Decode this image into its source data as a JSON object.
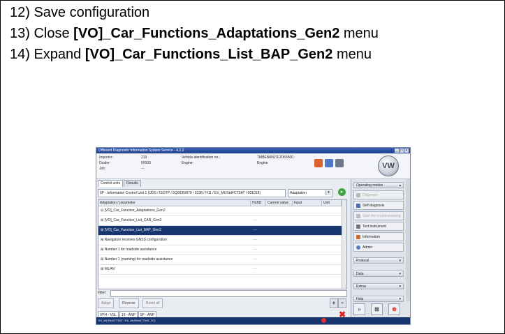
{
  "instructions": [
    {
      "text": "12) Save configuration",
      "bold": ""
    },
    {
      "text": "13) Close ",
      "bold": "[VO]_Car_Functions_Adaptations_Gen2",
      "suffix": " menu"
    },
    {
      "text": "14) Expand ",
      "bold": "[VO]_Car_Functions_List_BAP_Gen2",
      "suffix": " menu"
    }
  ],
  "app": {
    "title": "Offboard Diagnostic Information System Service - 4.2.3",
    "importer_label": "Importer:",
    "importer_value": "219",
    "dealer_label": "Dealer:",
    "dealer_value": "00000",
    "job_label": "Job:",
    "job_value": "---",
    "vin_label": "Vehicle identification no.:",
    "vin_value": "TMBEN6NJ7FZ065500",
    "engine_label": "Engine:",
    "engine_value": "Engine",
    "tabs": [
      "Control units",
      "Results"
    ],
    "ecu": "5F - Information Control Unit 1  (UDS / ISOTP / 5Q0035/870   / 0138 / H11 / EV_MUStd4CTSAT / 001018)",
    "mode": "Adaptation",
    "columns": [
      "Adaptation / parameter",
      "HLBD",
      "Current value",
      "Input",
      "Unit"
    ],
    "rows": [
      {
        "name": "[VO]_Car_Function_Adaptations_Gen2",
        "hlbd": "",
        "selected": false
      },
      {
        "name": "[VO]_Car_Function_List_CAN_Gen2",
        "hlbd": "----",
        "selected": false
      },
      {
        "name": "[VO]_Car_Function_List_BAP_Gen2",
        "hlbd": "----",
        "selected": true
      },
      {
        "name": "Navigation receives GNSS configuration",
        "hlbd": "----",
        "selected": false
      },
      {
        "name": "Number 1 for roadside assistance",
        "hlbd": "----",
        "selected": false
      },
      {
        "name": "Number 1 (roaming) for roadside assistance",
        "hlbd": "----",
        "selected": false
      },
      {
        "name": "WLAN",
        "hlbd": "----",
        "selected": false
      }
    ],
    "filter_label": "Filter:",
    "buttons": [
      "Adopt",
      "Reverse",
      "Reset all"
    ],
    "bottom_tabs": [
      "VFH - VSL",
      "19 - ANP",
      "5F - ANP"
    ],
    "status": "EV_MUStd4CTSAT / EV_MUStd4CTSAT_001",
    "right_panel": {
      "operating_modes": "Operating modes",
      "modes": [
        {
          "label": "Diagnosis",
          "enabled": false
        },
        {
          "label": "Self-diagnosis",
          "enabled": true
        },
        {
          "label": "Start the troubleshooting",
          "enabled": false
        },
        {
          "label": "Test instrument",
          "enabled": true
        },
        {
          "label": "Information",
          "enabled": true
        },
        {
          "label": "Admin",
          "enabled": true
        }
      ],
      "sections": [
        "Protocol",
        "Data",
        "Extras",
        "Help"
      ]
    },
    "logo_text": "VW",
    "colors": {
      "selected_row": "#17356f",
      "titlebar": "#2a4fa3",
      "go_button": "#3aa640",
      "close_red": "#d22222"
    }
  }
}
